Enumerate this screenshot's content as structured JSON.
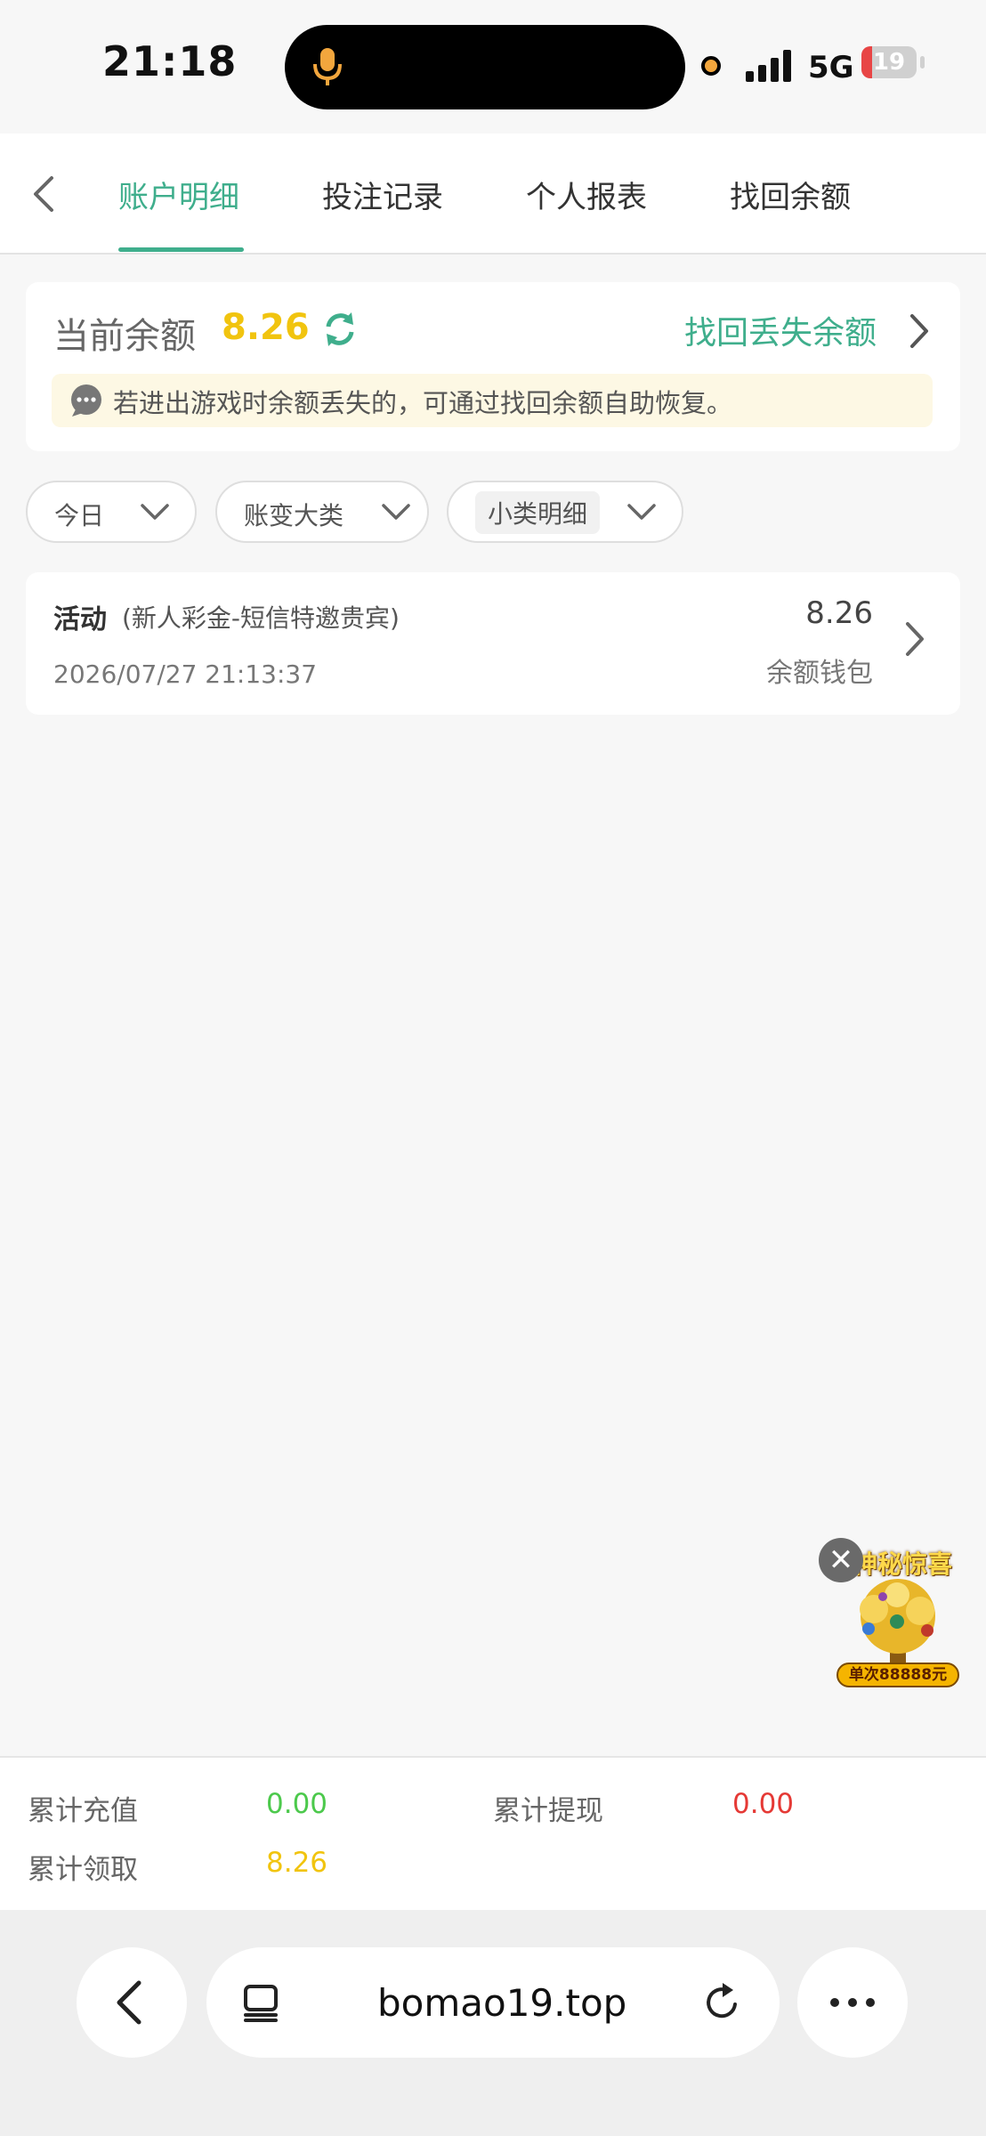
{
  "status_bar": {
    "time": "21:18",
    "network": "5G",
    "battery": "19",
    "battery_level": 0.19
  },
  "nav": {
    "tabs": [
      {
        "label": "账户明细",
        "active": true
      },
      {
        "label": "投注记录",
        "active": false
      },
      {
        "label": "个人报表",
        "active": false
      },
      {
        "label": "找回余额",
        "active": false
      }
    ]
  },
  "balance": {
    "label": "当前余额",
    "value": "8.26",
    "recover_link": "找回丢失余额",
    "notice": "若进出游戏时余额丢失的，可通过找回余额自助恢复。"
  },
  "filters": [
    {
      "label": "今日"
    },
    {
      "label": "账变大类"
    },
    {
      "label": "小类明细"
    }
  ],
  "records": [
    {
      "title": "活动",
      "subtitle": "(新人彩金-短信特邀贵宾)",
      "time": "2026/07/27 21:13:37",
      "amount": "8.26",
      "wallet": "余额钱包"
    }
  ],
  "promo": {
    "title": "神秘惊喜",
    "tag": "单次88888元"
  },
  "summary": {
    "recharge_label": "累计充值",
    "recharge_value": "0.00",
    "withdraw_label": "累计提现",
    "withdraw_value": "0.00",
    "claim_label": "累计领取",
    "claim_value": "8.26"
  },
  "browser": {
    "url": "bomao19.top"
  },
  "colors": {
    "accent": "#3fae8c",
    "balance_yellow": "#f1c40f",
    "green_value": "#4cc94c",
    "red_value": "#e53935"
  },
  "icons": [
    "microphone-icon",
    "signal-icon",
    "back-icon",
    "refresh-icon",
    "chevron-right-icon",
    "chat-bubble-icon",
    "chevron-down-icon",
    "close-icon",
    "tabs-icon",
    "reload-icon",
    "more-icon"
  ]
}
